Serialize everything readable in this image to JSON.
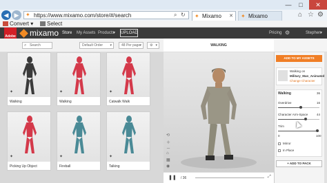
{
  "browser": {
    "url": "https://www.mixamo.com/store/#/search",
    "tabs": [
      {
        "title": "Mixamo",
        "active": true
      },
      {
        "title": "Mixamo",
        "active": false
      }
    ],
    "command_bar": {
      "convert_label": "Convert",
      "select_label": "Select"
    }
  },
  "header": {
    "badge": "Adobe",
    "brand": "mixamo",
    "nav": [
      "Store",
      "My Assets",
      "Products"
    ],
    "upload_label": "UPLOAD",
    "pricing_label": "Pricing",
    "user_label": "Stephen"
  },
  "toolbar": {
    "search_placeholder": "Search",
    "order_label": "Default Order",
    "per_page_label": "48 Per page"
  },
  "assets": [
    {
      "label": "Walking",
      "color": "#3a3a3a"
    },
    {
      "label": "Walking",
      "color": "#d4394a"
    },
    {
      "label": "Catwalk Walk",
      "color": "#d4394a"
    },
    {
      "label": "Picking Up Object",
      "color": "#d4394a"
    },
    {
      "label": "Fireball",
      "color": "#4a8a96"
    },
    {
      "label": "Talking",
      "color": "#4a8a96"
    }
  ],
  "preview": {
    "title": "WALKING",
    "frame_label": "/ 36"
  },
  "panel": {
    "add_to_assets": "ADD TO MY ASSETS",
    "character_label": "Walking on",
    "character_name": "Military_Man_Animated",
    "change_character": "Change Character",
    "section_title": "Walking",
    "section_value": "36",
    "params": [
      {
        "label": "Overdrive",
        "value": "16",
        "fraction": 0.55
      },
      {
        "label": "Character Arm-Space",
        "value": "44",
        "fraction": 0.66
      },
      {
        "label": "Trim",
        "value": "100",
        "fraction": 0.95
      }
    ],
    "trim_start": "0",
    "checkboxes": [
      "Mirror",
      "In Place"
    ],
    "add_to_pack": "+ ADD TO PACK"
  },
  "colors": {
    "accent": "#f07e26",
    "header_bg": "#3a3a3a",
    "adobe_red": "#d21f26"
  }
}
